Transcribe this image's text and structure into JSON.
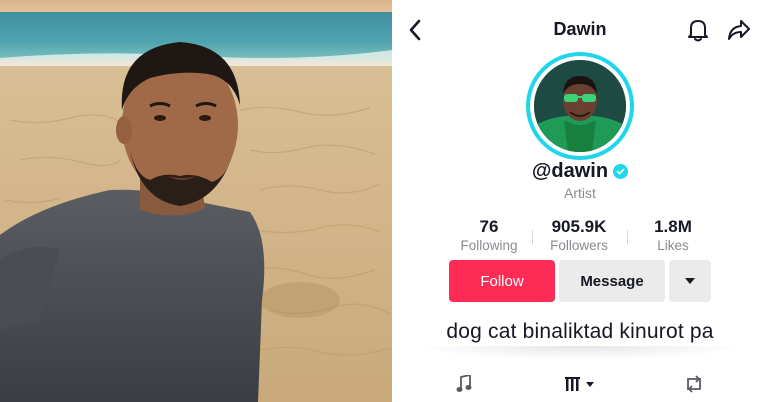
{
  "header": {
    "title": "Dawin"
  },
  "profile": {
    "handle": "@dawin",
    "verified": true,
    "role": "Artist",
    "stats": [
      {
        "value": "76",
        "label": "Following"
      },
      {
        "value": "905.9K",
        "label": "Followers"
      },
      {
        "value": "1.8M",
        "label": "Likes"
      }
    ],
    "bio": "dog cat binaliktad kinurot pa"
  },
  "actions": {
    "follow_label": "Follow",
    "message_label": "Message"
  },
  "icons": {
    "back": "chevron-left-icon",
    "bell": "bell-icon",
    "share": "share-arrow-icon",
    "verified": "verified-check-icon",
    "more": "caret-down-icon",
    "music_tab": "music-note-icon",
    "videos_tab": "grid-bars-icon",
    "repost_tab": "repost-icon"
  },
  "colors": {
    "follow": "#fe2c55",
    "message": "#ebebec",
    "avatar_ring": "#20d5ec",
    "verified": "#20d5ec",
    "text": "#161823",
    "secondary_text": "#8a8b91"
  }
}
